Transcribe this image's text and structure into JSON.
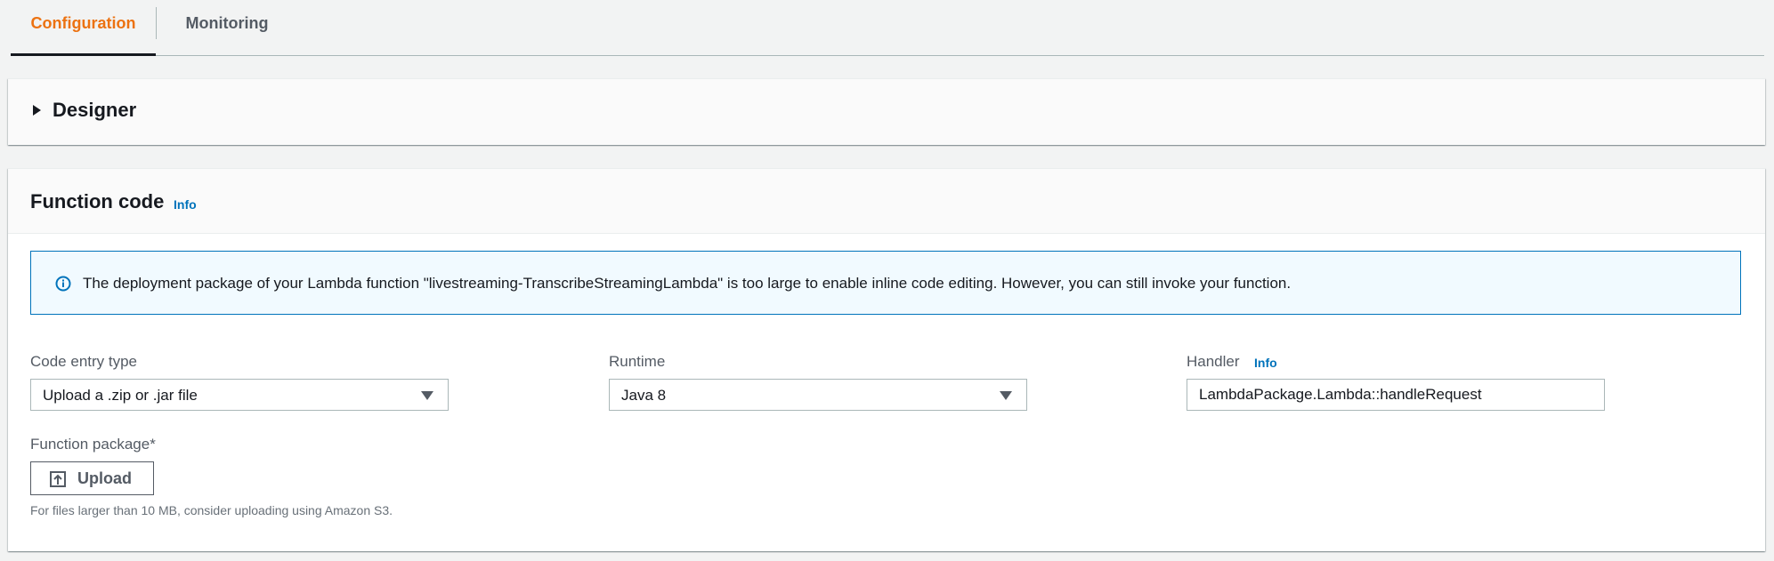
{
  "tabs": [
    {
      "label": "Configuration",
      "active": true
    },
    {
      "label": "Monitoring",
      "active": false
    }
  ],
  "designer": {
    "title": "Designer",
    "expanded": false
  },
  "function_code": {
    "title": "Function code",
    "info_label": "Info",
    "alert": {
      "icon": "info-circle-icon",
      "message": "The deployment package of your Lambda function \"livestreaming-TranscribeStreamingLambda\" is too large to enable inline code editing. However, you can still invoke your function."
    },
    "code_entry_type": {
      "label": "Code entry type",
      "value": "Upload a .zip or .jar file"
    },
    "runtime": {
      "label": "Runtime",
      "value": "Java 8"
    },
    "handler": {
      "label": "Handler",
      "info_label": "Info",
      "value": "LambdaPackage.Lambda::handleRequest"
    },
    "function_package": {
      "label": "Function package*",
      "upload_label": "Upload",
      "hint": "For files larger than 10 MB, consider uploading using Amazon S3."
    }
  },
  "colors": {
    "accent": "#ec7211",
    "link": "#0073bb",
    "alert_bg": "#f1faff",
    "page_bg": "#f2f3f3"
  }
}
